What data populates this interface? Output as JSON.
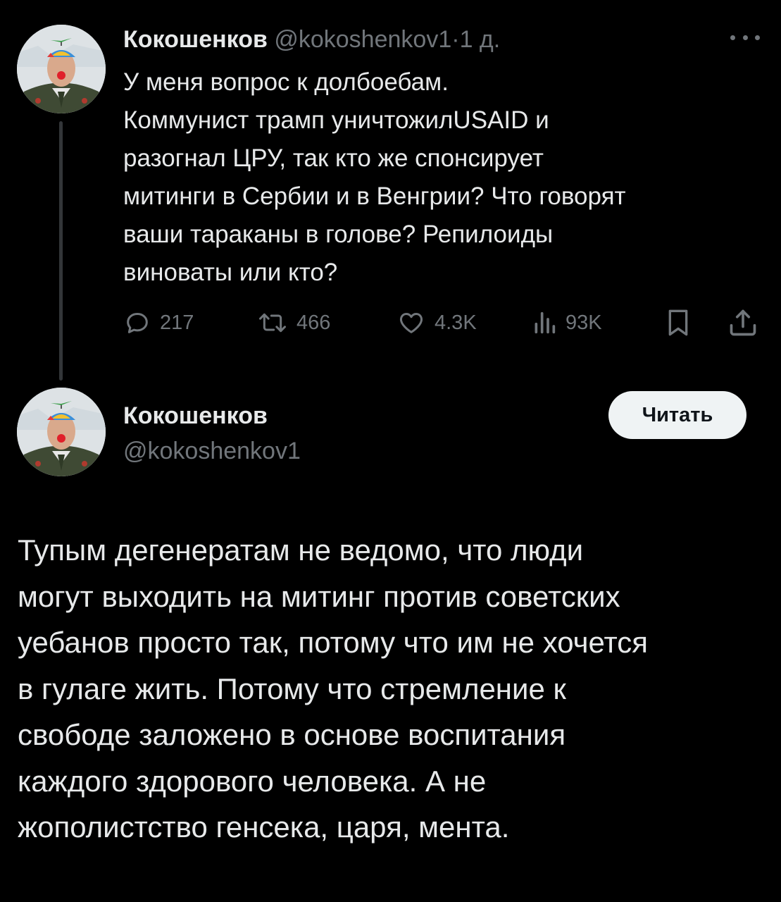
{
  "tweet1": {
    "author_name": "Кокошенков",
    "handle": "@kokoshenkov1",
    "separator": "·",
    "time": "1 д.",
    "text": "У меня вопрос к долбоебам.\nКоммунист трамп уничтожилUSAID и\nразогнал ЦРУ, так кто же спонсирует\nмитинги в Сербии и в Венгрии? Что говорят\nваши тараканы в голове? Репилоиды\nвиноваты или кто?",
    "actions": {
      "replies": "217",
      "reposts": "466",
      "likes": "4.3K",
      "views": "93K"
    },
    "more_icon": "more-horizontal-icon"
  },
  "profile": {
    "name": "Кокошенков",
    "handle": "@kokoshenkov1",
    "follow_label": "Читать"
  },
  "tweet2": {
    "text": "Тупым дегенератам не ведомо, что люди\nмогут выходить на митинг против советских\nуебанов просто так, потому что им не хочется\nв гулаге жить. Потому что стремление к\nсвободе заложено в основе воспитания\nкаждого здорового человека. А не\nжополистство генсека, царя, мента."
  },
  "colors": {
    "background": "#000000",
    "text_primary": "#e7e9ea",
    "text_secondary": "#71767b",
    "button_bg": "#eff3f4",
    "thread_line": "#333639"
  },
  "icons": [
    "reply-icon",
    "repost-icon",
    "like-icon",
    "views-icon",
    "bookmark-icon",
    "share-icon",
    "more-horizontal-icon"
  ]
}
